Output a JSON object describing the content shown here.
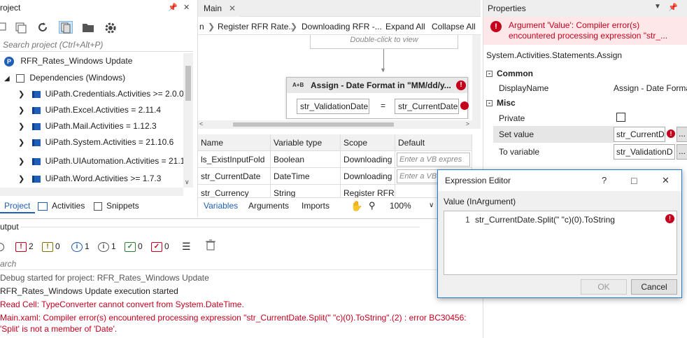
{
  "project_panel": {
    "title": "roject",
    "pin": "ₕ",
    "close": "✕",
    "search_placeholder": "Search project (Ctrl+Alt+P)",
    "project_name": "RFR_Rates_Windows Update",
    "dependencies_label": "Dependencies (Windows)",
    "packages": [
      "UiPath.Credentials.Activities >= 2.0.0",
      "UiPath.Excel.Activities = 2.11.4",
      "UiPath.Mail.Activities = 1.12.3",
      "UiPath.System.Activities = 21.10.6",
      "UiPath.UIAutomation.Activities = 21.1",
      "UiPath.Word.Activities >= 1.7.3"
    ],
    "tabs": [
      "Project",
      "Activities",
      "Snippets"
    ]
  },
  "designer": {
    "tab_title": "Main",
    "breadcrumb": [
      "n",
      "Register RFR Rate...",
      "Downloading RFR -..."
    ],
    "expand_all": "Expand All",
    "collapse_all": "Collapse All",
    "hint": "Double-click to view",
    "assign": {
      "badge": "A+B",
      "title": "Assign - Date Format in \"MM/dd/y...",
      "to": "str_ValidationDate",
      "eq": "=",
      "value": "str_CurrentDate"
    },
    "grid": {
      "headers": [
        "Name",
        "Variable type",
        "Scope",
        "Default"
      ],
      "rows": [
        [
          "ls_ExistInputFold",
          "Boolean",
          "Downloading",
          "Enter a VB expres"
        ],
        [
          "str_CurrentDate",
          "DateTime",
          "Downloading",
          "Enter a VB"
        ],
        [
          "str_Currency",
          "String",
          "Register RFR R",
          ""
        ]
      ]
    },
    "bottom_tabs": [
      "Variables",
      "Arguments",
      "Imports"
    ],
    "zoom": "100%"
  },
  "properties": {
    "title": "Properties",
    "error_text": "Argument 'Value': Compiler error(s) encountered processing expression \"str_...",
    "activity_type": "System.Activities.Statements.Assign",
    "sections": {
      "common": "Common",
      "misc": "Misc"
    },
    "display_name_label": "DisplayName",
    "display_name_value": "Assign - Date Forma",
    "private_label": "Private",
    "set_value_label": "Set value",
    "set_value_value": "str_CurrentD",
    "to_variable_label": "To variable",
    "to_variable_value": "str_ValidationD",
    "ellipsis": "..."
  },
  "output": {
    "title": "utput",
    "filters": [
      {
        "count": "2",
        "color": "#c4001d"
      },
      {
        "count": "0",
        "color": "#8a6d00"
      },
      {
        "count": "1",
        "color": "#1f5fb7"
      },
      {
        "count": "1",
        "color": "#555555"
      },
      {
        "count": "0",
        "color": "#2e7d32"
      },
      {
        "count": "0",
        "color": "#c4001d"
      }
    ],
    "search_placeholder": "arch",
    "lines": [
      {
        "text": "Debug started for project: RFR_Rates_Windows Update",
        "kind": "info"
      },
      {
        "text": "RFR_Rates_Windows Update execution started",
        "kind": "normal"
      },
      {
        "text": "Read Cell: TypeConverter cannot convert from System.DateTime.",
        "kind": "error"
      },
      {
        "text": "Main.xaml: Compiler error(s) encountered processing expression \"str_CurrentDate.Split(\" \"c)(0).ToString\".(2) : error BC30456:",
        "kind": "error"
      },
      {
        "text": "'Split' is not a member of 'Date'.",
        "kind": "error"
      }
    ]
  },
  "expression_editor": {
    "title": "Expression Editor",
    "help": "?",
    "maximize": "□",
    "close": "✕",
    "label": "Value (InArgument)",
    "line_number": "1",
    "code": "str_CurrentDate.Split(\" \"c)(0).ToString",
    "ok": "OK",
    "cancel": "Cancel"
  }
}
